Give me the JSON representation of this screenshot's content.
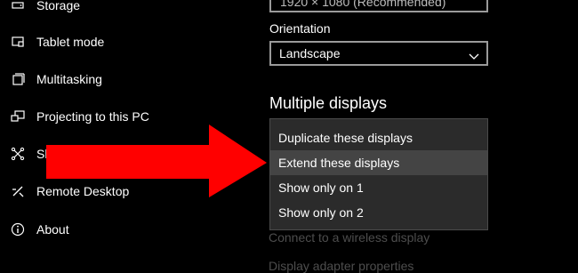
{
  "sidebar": {
    "items": [
      {
        "label": "Storage",
        "icon": "storage-icon"
      },
      {
        "label": "Tablet mode",
        "icon": "tablet-icon"
      },
      {
        "label": "Multitasking",
        "icon": "multitasking-icon"
      },
      {
        "label": "Projecting to this PC",
        "icon": "projecting-icon"
      },
      {
        "label": "Shared experiences",
        "icon": "shared-icon"
      },
      {
        "label": "Remote Desktop",
        "icon": "remote-desktop-icon"
      },
      {
        "label": "About",
        "icon": "info-icon"
      }
    ]
  },
  "display": {
    "resolution_value": "1920 × 1080 (Recommended)",
    "orientation_label": "Orientation",
    "orientation_value": "Landscape",
    "multiple_displays_title": "Multiple displays",
    "multiple_displays_options": [
      "Duplicate these displays",
      "Extend these displays",
      "Show only on 1",
      "Show only on 2"
    ],
    "highlighted_option": "Extend these displays",
    "connect_link": "Connect to a wireless display",
    "adapter_link": "Display adapter properties"
  },
  "colors": {
    "background": "#000000",
    "dropdown_bg": "#2b2b2b",
    "hover_bg": "#444444",
    "arrow": "#ff0000",
    "muted_link": "#4d4d4d"
  }
}
